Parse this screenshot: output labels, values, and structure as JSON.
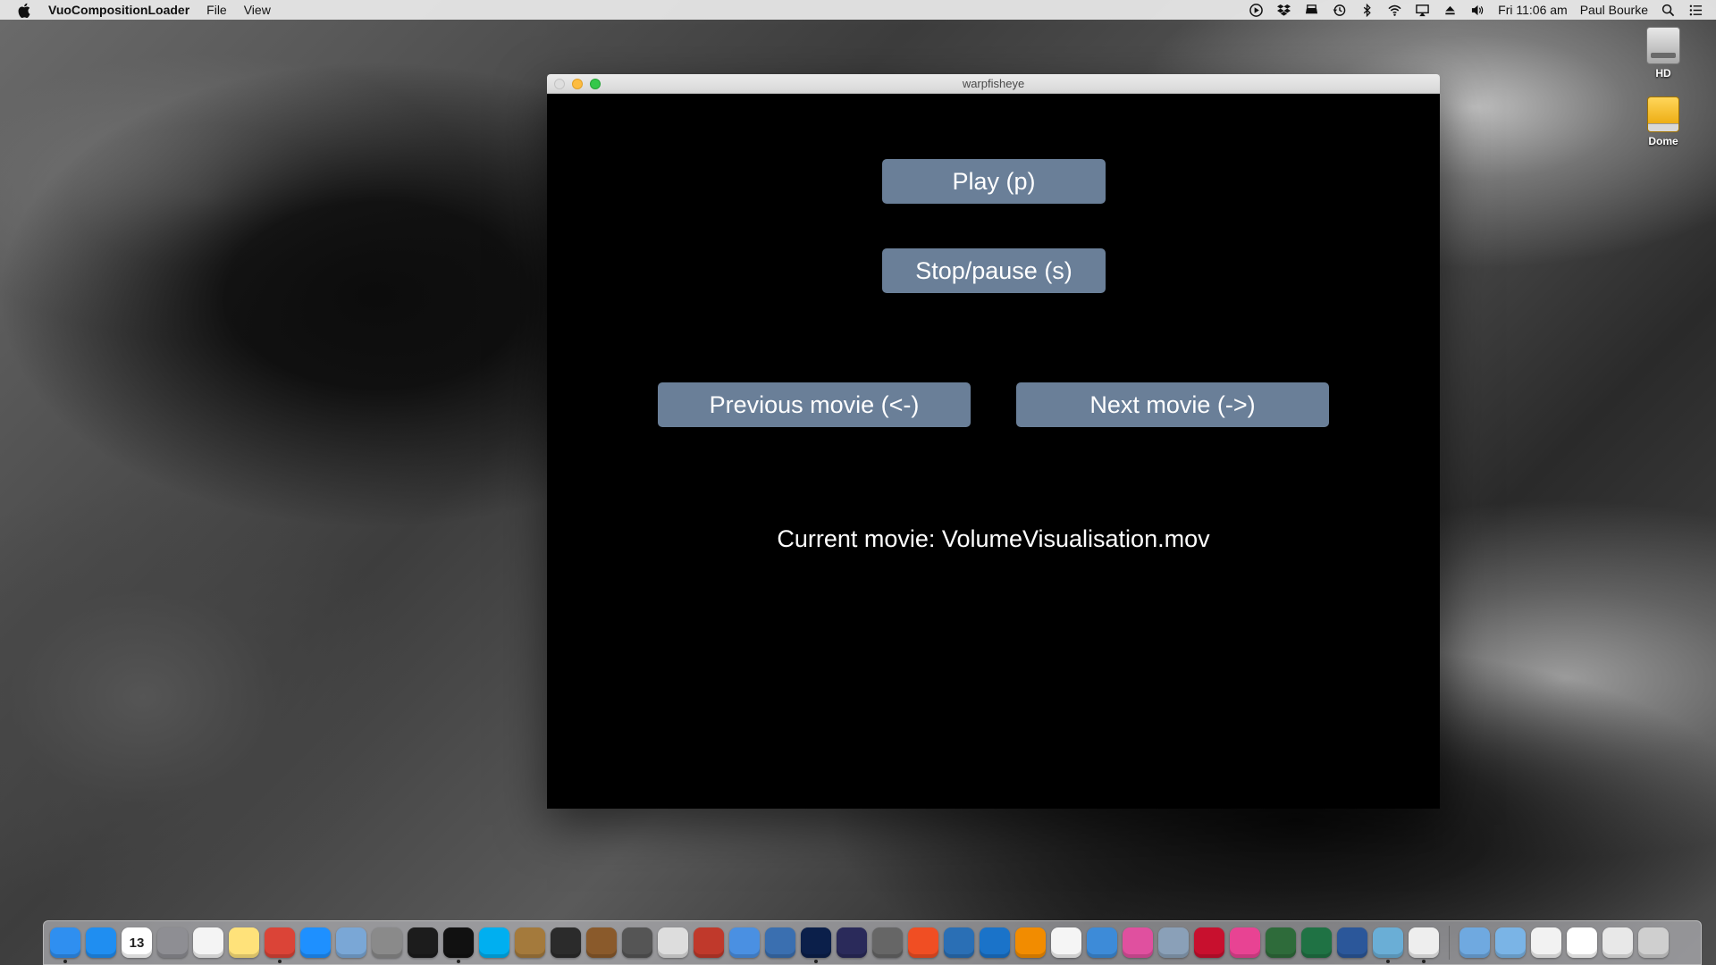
{
  "menubar": {
    "app_name": "VuoCompositionLoader",
    "menus": [
      "File",
      "View"
    ],
    "status_icons": [
      "play-circle-icon",
      "dropbox-icon",
      "drive-icon",
      "time-machine-icon",
      "bluetooth-icon",
      "wifi-icon",
      "airplay-icon",
      "eject-icon",
      "volume-icon"
    ],
    "clock": "Fri 11:06 am",
    "user": "Paul Bourke",
    "right_icons": [
      "spotlight-search-icon",
      "notification-center-icon"
    ]
  },
  "desktop": {
    "icons": [
      {
        "label": "HD",
        "icon": "hard-drive-icon"
      },
      {
        "label": "Dome",
        "icon": "external-drive-icon"
      }
    ]
  },
  "window": {
    "title": "warpfisheye",
    "buttons": {
      "play": "Play (p)",
      "stop": "Stop/pause (s)",
      "previous": "Previous movie (<-)",
      "next": "Next movie (->)"
    },
    "current_movie": "Current movie: VolumeVisualisation.mov"
  },
  "dock": {
    "calendar_day": "13",
    "apps": [
      {
        "icon": "finder-icon",
        "color": "#2f8ff0",
        "running": true
      },
      {
        "icon": "app-store-icon",
        "color": "#1f8ef1",
        "running": false
      },
      {
        "icon": "calendar-icon",
        "color": "#ffffff",
        "running": false
      },
      {
        "icon": "system-preferences-icon",
        "color": "#8e8e93",
        "running": false
      },
      {
        "icon": "textedit-icon",
        "color": "#f4f4f4",
        "running": false
      },
      {
        "icon": "notes-icon",
        "color": "#ffe27a",
        "running": false
      },
      {
        "icon": "chrome-icon",
        "color": "#db4437",
        "running": true
      },
      {
        "icon": "safari-icon",
        "color": "#1e90ff",
        "running": false
      },
      {
        "icon": "preview-icon",
        "color": "#7aa7d6",
        "running": false
      },
      {
        "icon": "automator-icon",
        "color": "#8a8a8a",
        "running": false
      },
      {
        "icon": "activity-monitor-icon",
        "color": "#1c1c1c",
        "running": false
      },
      {
        "icon": "terminal-icon",
        "color": "#111111",
        "running": true
      },
      {
        "icon": "skype-icon",
        "color": "#00aff0",
        "running": false
      },
      {
        "icon": "archive-icon",
        "color": "#a47a3c",
        "running": false
      },
      {
        "icon": "console-icon",
        "color": "#2b2b2b",
        "running": false
      },
      {
        "icon": "bird-app-icon",
        "color": "#8a5a2b",
        "running": false
      },
      {
        "icon": "final-cut-icon",
        "color": "#555555",
        "running": false
      },
      {
        "icon": "x11-icon",
        "color": "#dddddd",
        "running": false
      },
      {
        "icon": "photo-booth-icon",
        "color": "#c0392b",
        "running": false
      },
      {
        "icon": "mail-icon",
        "color": "#4a90e2",
        "running": false
      },
      {
        "icon": "image-capture-icon",
        "color": "#3a6fb0",
        "running": false
      },
      {
        "icon": "photoshop-icon",
        "color": "#0b1f4a",
        "running": true
      },
      {
        "icon": "after-effects-icon",
        "color": "#2a2a5a",
        "running": false
      },
      {
        "icon": "eye-app-icon",
        "color": "#666666",
        "running": false
      },
      {
        "icon": "app-icon",
        "color": "#f04e23",
        "running": false
      },
      {
        "icon": "ptp-icon",
        "color": "#2a6fb5",
        "running": false
      },
      {
        "icon": "quicktime-icon",
        "color": "#1a73c9",
        "running": false
      },
      {
        "icon": "vlc-icon",
        "color": "#f28c00",
        "running": false
      },
      {
        "icon": "photos-icon",
        "color": "#f5f5f5",
        "running": false
      },
      {
        "icon": "grapher-icon",
        "color": "#3d8bd8",
        "running": false
      },
      {
        "icon": "itunes-icon",
        "color": "#e0509f",
        "running": false
      },
      {
        "icon": "scanner-icon",
        "color": "#8aa0b8",
        "running": false
      },
      {
        "icon": "acrobat-icon",
        "color": "#c8102e",
        "running": false
      },
      {
        "icon": "color-cube-icon",
        "color": "#e84393",
        "running": false
      },
      {
        "icon": "chalkboard-icon",
        "color": "#2e6b3a",
        "running": false
      },
      {
        "icon": "excel-icon",
        "color": "#1f7244",
        "running": false
      },
      {
        "icon": "word-icon",
        "color": "#2b579a",
        "running": false
      },
      {
        "icon": "vuo-icon",
        "color": "#6aaed6",
        "running": true
      },
      {
        "icon": "vuo-composition-loader-icon",
        "color": "#eeeeee",
        "running": true
      }
    ],
    "stacks": [
      {
        "icon": "downloads-folder-icon",
        "color": "#6fa9e0"
      },
      {
        "icon": "dropbox-folder-icon",
        "color": "#7ab4e6"
      },
      {
        "icon": "document-stack-icon",
        "color": "#f2f2f2"
      },
      {
        "icon": "document-icon",
        "color": "#ffffff"
      },
      {
        "icon": "screenshot-stack-icon",
        "color": "#e8e8e8"
      },
      {
        "icon": "trash-icon",
        "color": "#cfcfcf"
      }
    ]
  }
}
